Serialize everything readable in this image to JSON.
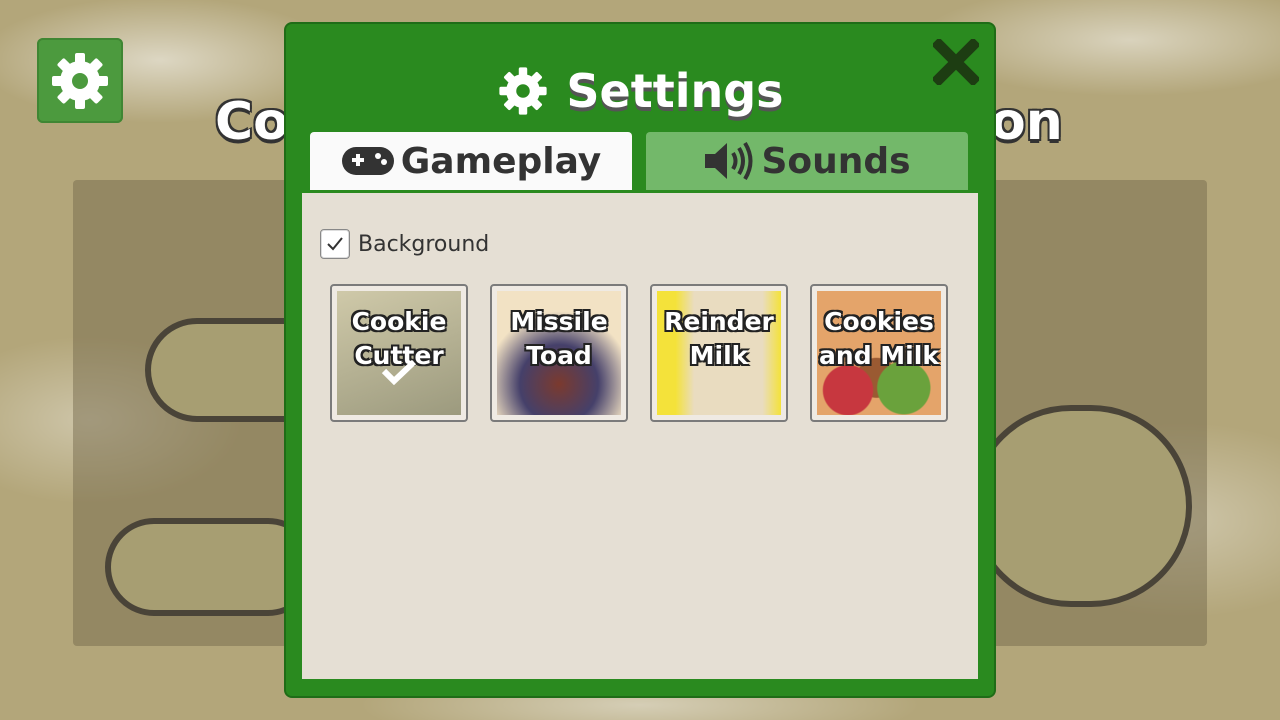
{
  "background_scene": {
    "title_left": "Co",
    "title_right": "on"
  },
  "dialog": {
    "title": "Settings",
    "tabs": [
      {
        "label": "Gameplay",
        "icon": "gamepad-icon",
        "active": false
      },
      {
        "label": "Sounds",
        "icon": "speaker-icon",
        "active": true
      }
    ],
    "background_checkbox": {
      "label": "Background",
      "checked": true
    },
    "tracks": [
      {
        "label": "Cookie\nCutter",
        "selected": true,
        "colors": [
          "#9c9a7e",
          "#cfc9a9"
        ]
      },
      {
        "label": "Missile\nToad",
        "selected": false,
        "colors": [
          "#f2e2c4",
          "#7b3a2e"
        ]
      },
      {
        "label": "Reinder\nMilk",
        "selected": false,
        "colors": [
          "#f4e23a",
          "#e9dcc0"
        ]
      },
      {
        "label": "Cookies\nand Milk",
        "selected": false,
        "colors": [
          "#e4a46a",
          "#c7373f"
        ]
      }
    ]
  },
  "colors": {
    "dialog_green": "#2a8a1f",
    "active_tab": "#73b86a",
    "inactive_tab": "#fafafa",
    "panel": "#e5dfd4"
  }
}
